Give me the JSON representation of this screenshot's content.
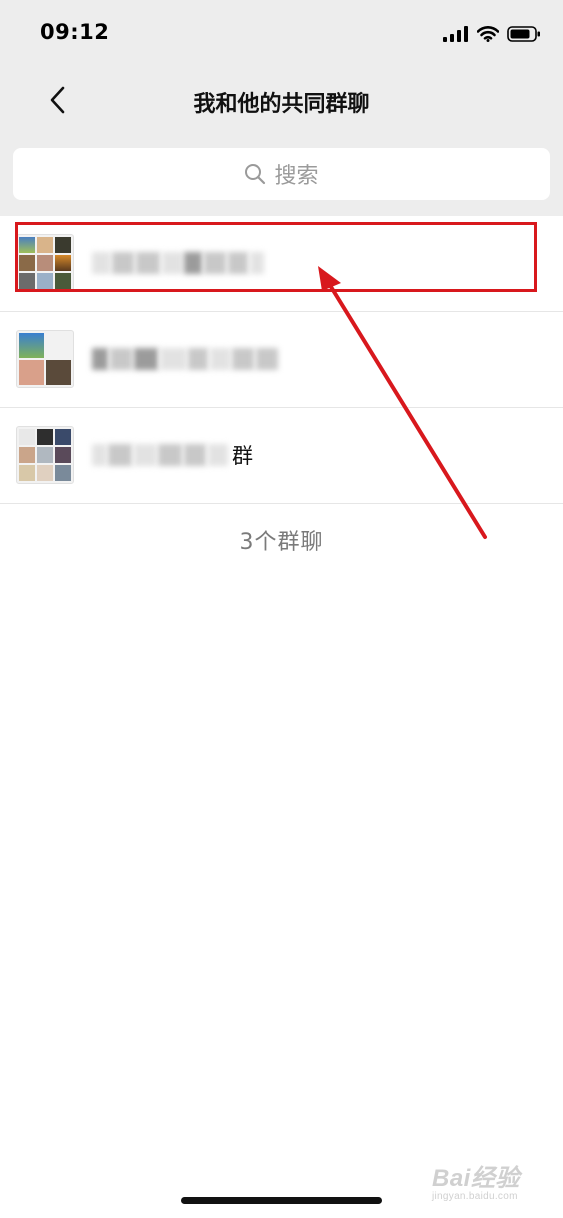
{
  "status_bar": {
    "time": "09:12"
  },
  "nav": {
    "title": "我和他的共同群聊"
  },
  "search": {
    "placeholder": "搜索"
  },
  "groups": [
    {
      "name_visible_tail": "",
      "highlighted": true
    },
    {
      "name_visible_tail": "",
      "highlighted": false
    },
    {
      "name_visible_tail": "群",
      "highlighted": false
    }
  ],
  "footer": {
    "count_text": "3个群聊"
  },
  "annotation": {
    "color": "#d8181d"
  },
  "watermark": {
    "main": "Bai经验",
    "sub": "jingyan.baidu.com"
  },
  "icons": [
    "signal-icon",
    "wifi-icon",
    "battery-icon",
    "back-chevron-icon",
    "search-icon"
  ]
}
